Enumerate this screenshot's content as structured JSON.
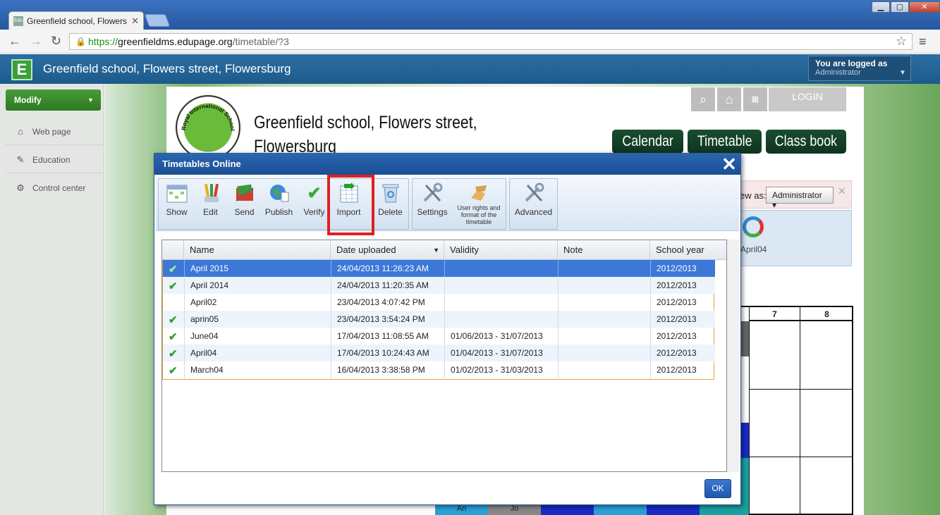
{
  "browser": {
    "tab_title": "Greenfield school, Flowers st",
    "tab_favicon": "Edu",
    "url_scheme": "https://",
    "url_host": "greenfieldms.edupage.org",
    "url_path": "/timetable/?3"
  },
  "app": {
    "logo_letter": "E",
    "title": "Greenfield school, Flowers street, Flowersburg",
    "logged_label": "You are logged as",
    "logged_user": "Administrator"
  },
  "sidebar": {
    "modify_label": "Modify",
    "items": [
      {
        "label": "Web page",
        "icon": "house-icon"
      },
      {
        "label": "Education",
        "icon": "graduation-icon"
      },
      {
        "label": "Control center",
        "icon": "gear-icon"
      }
    ]
  },
  "page": {
    "school_name_line1": "Greenfield school, Flowers street,",
    "school_name_line2": "Flowersburg",
    "logo_text": "Royal International School London",
    "login_label": "LOGIN",
    "nav_buttons": [
      "Calendar",
      "Timetable",
      "Class book"
    ],
    "view_as_label": "ew as:",
    "view_as_value": "Administrator",
    "panel_label": "April04",
    "grid_headers": [
      "7",
      "8"
    ],
    "bottom_labels": [
      "An",
      "Jo"
    ]
  },
  "dialog": {
    "title": "Timetables Online",
    "toolbar": {
      "show": "Show",
      "edit": "Edit",
      "send": "Send",
      "publish": "Publish",
      "verify": "Verify",
      "import": "Import",
      "delete": "Delete",
      "settings": "Settings",
      "user_rights": "User rights and format of the timetable",
      "advanced": "Advanced"
    },
    "columns": [
      "Name",
      "Date uploaded",
      "Validity",
      "Note",
      "School year"
    ],
    "rows": [
      {
        "checked": true,
        "name": "April 2015",
        "date": "24/04/2013 11:26:23 AM",
        "validity": "",
        "note": "",
        "year": "2012/2013"
      },
      {
        "checked": true,
        "name": "April 2014",
        "date": "24/04/2013 11:20:35 AM",
        "validity": "",
        "note": "",
        "year": "2012/2013"
      },
      {
        "checked": false,
        "name": "April02",
        "date": "23/04/2013 4:07:42 PM",
        "validity": "",
        "note": "",
        "year": "2012/2013"
      },
      {
        "checked": true,
        "name": "aprin05",
        "date": "23/04/2013 3:54:24 PM",
        "validity": "",
        "note": "",
        "year": "2012/2013"
      },
      {
        "checked": true,
        "name": "June04",
        "date": "17/04/2013 11:08:55 AM",
        "validity": "01/06/2013 - 31/07/2013",
        "note": "",
        "year": "2012/2013"
      },
      {
        "checked": true,
        "name": "April04",
        "date": "17/04/2013 10:24:43 AM",
        "validity": "01/04/2013 - 31/07/2013",
        "note": "",
        "year": "2012/2013"
      },
      {
        "checked": true,
        "name": "March04",
        "date": "16/04/2013 3:38:58 PM",
        "validity": "01/02/2013 - 31/03/2013",
        "note": "",
        "year": "2012/2013"
      }
    ],
    "ok_label": "OK"
  },
  "colors": {
    "selected_row": "#3c78d8",
    "dialog_title": "#1a4f94",
    "nav_dark_green": "#0f3320",
    "highlight": "#e02020"
  }
}
